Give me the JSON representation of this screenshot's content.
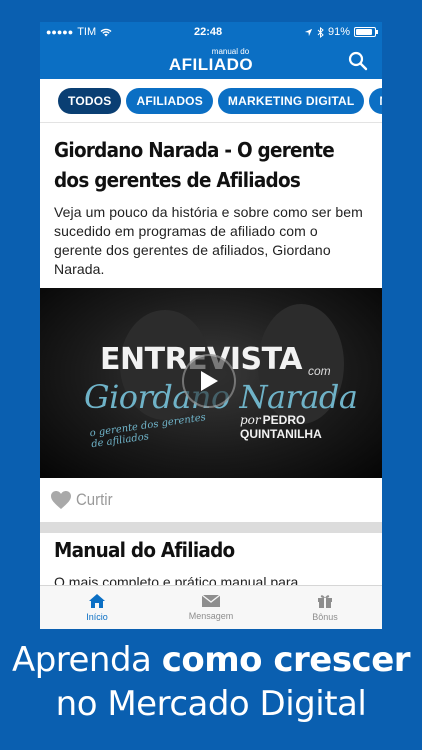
{
  "status_bar": {
    "carrier": "TIM",
    "time": "22:48",
    "battery": "91%",
    "battery_level": 0.91
  },
  "navbar": {
    "logo_small": "manual do",
    "logo_big": "AFILIADO",
    "icons": [
      "search-icon"
    ]
  },
  "categories": [
    {
      "label": "TODOS",
      "active": true
    },
    {
      "label": "AFILIADOS",
      "active": false
    },
    {
      "label": "MARKETING DIGITAL",
      "active": false
    },
    {
      "label": "MIN",
      "active": false
    }
  ],
  "feed": [
    {
      "title": "Giordano Narada - O gerente dos gerentes de Afiliados",
      "description": "Veja um pouco da história e sobre como ser bem sucedido em programas de afiliado com o gerente dos gerentes de afiliados, Giordano Narada.",
      "video": {
        "line1": "ENTREVISTA",
        "com": "com",
        "name": "Giordano Narada",
        "sub": "o gerente dos gerentes de afiliados",
        "por": "por",
        "author": "PEDRO QUINTANILHA"
      },
      "like_label": "Curtir"
    },
    {
      "title": "Manual do Afiliado",
      "description": "O mais completo e prático manual para"
    }
  ],
  "tabbar": {
    "tabs": [
      {
        "label": "Início",
        "icon": "home-icon",
        "active": true
      },
      {
        "label": "Mensagem",
        "icon": "envelope-icon",
        "active": false
      },
      {
        "label": "Bônus",
        "icon": "gift-icon",
        "active": false
      }
    ]
  },
  "caption": {
    "part1": "Aprenda ",
    "bold": "como crescer",
    "line2": "no Mercado Digital"
  },
  "colors": {
    "background": "#0a5fb0",
    "brand": "#0b6fc4",
    "chip_active": "#0a3f73"
  }
}
